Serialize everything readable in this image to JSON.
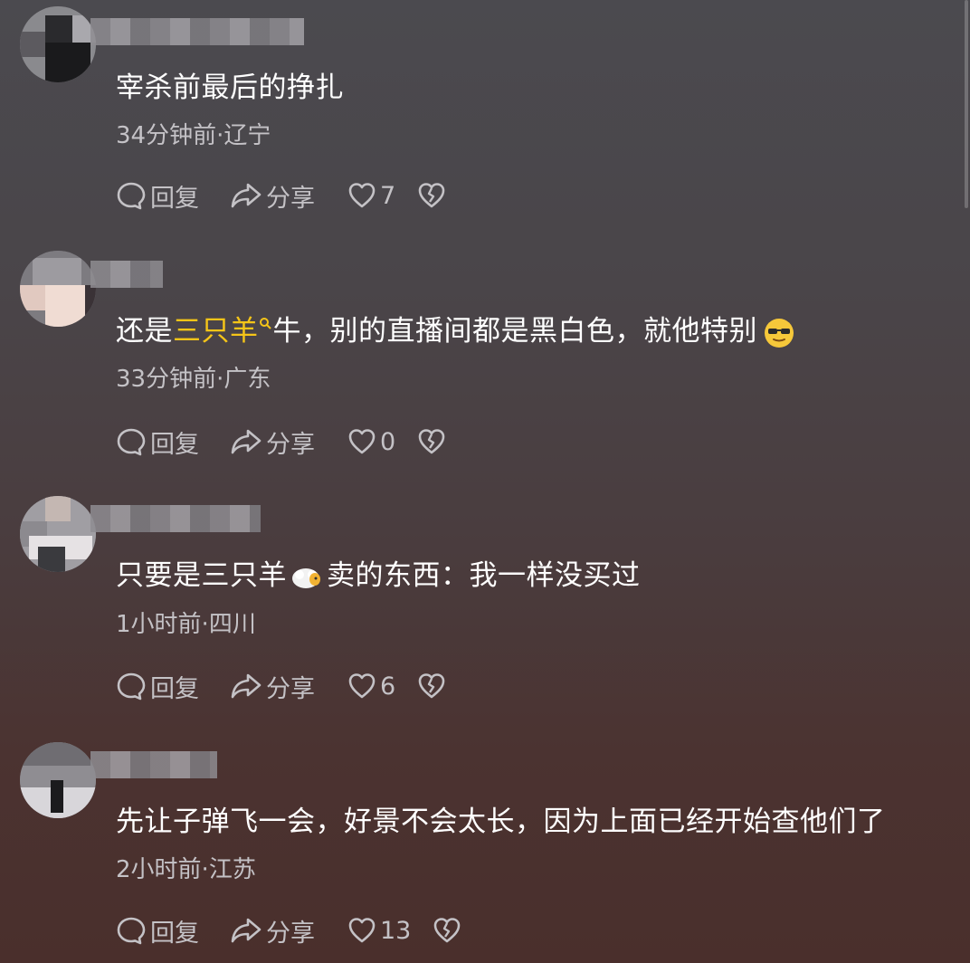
{
  "labels": {
    "reply": "回复",
    "share": "分享"
  },
  "comments": [
    {
      "text": "宰杀前最后的挣扎",
      "time": "34分钟前",
      "location": "辽宁",
      "likes": "7"
    },
    {
      "text_before": "还是",
      "link": "三只羊",
      "text_after": "牛，别的直播间都是黑白色，就他特别",
      "emoji": "sunglasses-emoji",
      "time": "33分钟前",
      "location": "广东",
      "likes": "0"
    },
    {
      "text_before": "只要是三只羊",
      "emoji": "sheep-emoji",
      "text_after": "卖的东西：我一样没买过",
      "time": "1小时前",
      "location": "四川",
      "likes": "6"
    },
    {
      "text": "先让子弹飞一会，好景不会太长，因为上面已经开始查他们了",
      "time": "2小时前",
      "location": "江苏",
      "likes": "13"
    }
  ],
  "colors": {
    "highlight": "#f5c518",
    "meta": "#c4c2c6"
  }
}
